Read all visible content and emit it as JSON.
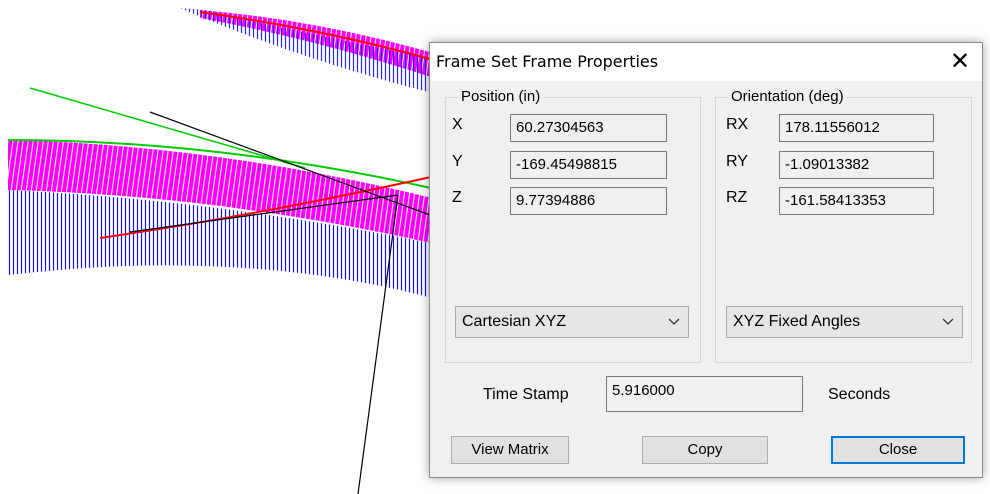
{
  "dialog": {
    "title": "Frame Set Frame Properties",
    "close_glyph": "✕",
    "position": {
      "title": "Position (in)",
      "labels": [
        "X",
        "Y",
        "Z"
      ],
      "values": [
        "60.27304563",
        "-169.45498815",
        "9.77394886"
      ],
      "coord_system": "Cartesian XYZ"
    },
    "orientation": {
      "title": "Orientation (deg)",
      "labels": [
        "RX",
        "RY",
        "RZ"
      ],
      "values": [
        "178.11556012",
        "-1.09013382",
        "-161.58413353"
      ],
      "convention": "XYZ Fixed Angles"
    },
    "time_stamp": {
      "label": "Time Stamp",
      "value": "5.916000",
      "unit": "Seconds"
    },
    "buttons": {
      "view_matrix": "View Matrix",
      "copy": "Copy",
      "close": "Close"
    }
  },
  "colors": {
    "magenta": "#ff00ff",
    "blue": "#0000ff",
    "red": "#ff0000",
    "green": "#00cc00",
    "accent": "#0078d7"
  },
  "icons": {
    "dropdown": "chevron-down-icon",
    "close": "close-icon"
  }
}
